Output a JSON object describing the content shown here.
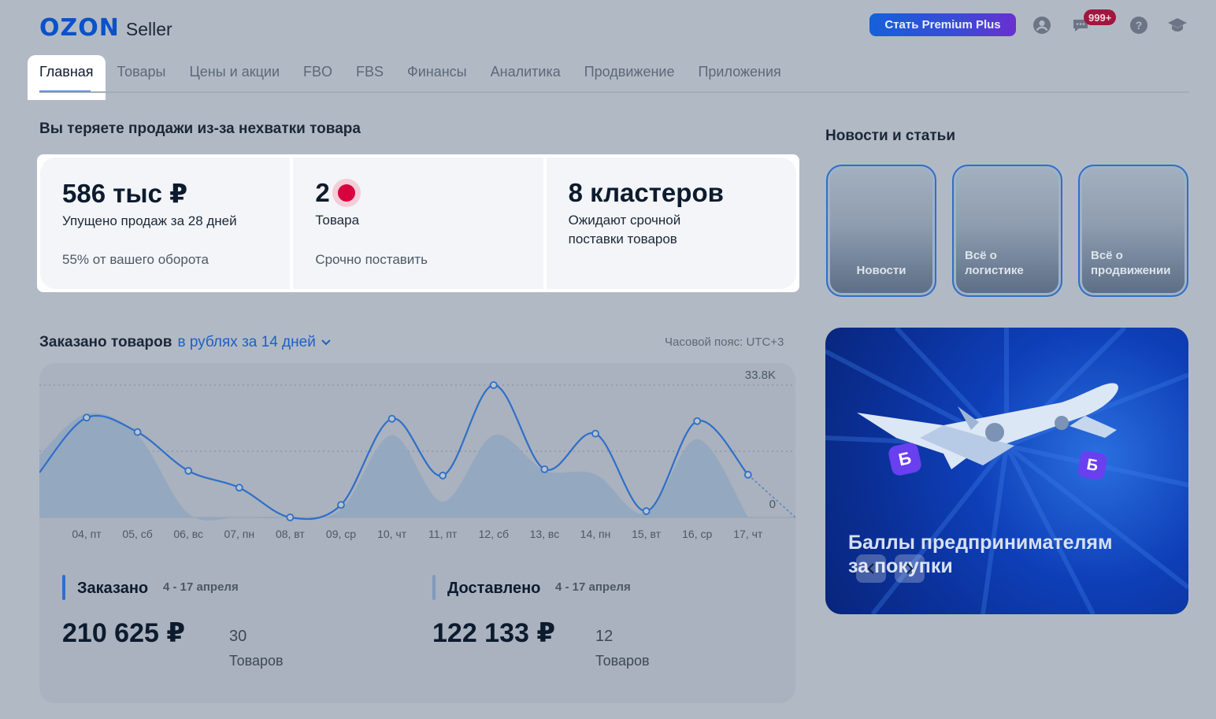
{
  "header": {
    "logo_main": "OZON",
    "logo_sub": "Seller",
    "premium_button": "Стать Premium Plus",
    "notifications_badge": "999+",
    "icons": [
      "profile-icon",
      "chat-icon",
      "help-icon",
      "education-icon"
    ]
  },
  "nav": {
    "tabs": [
      "Главная",
      "Товары",
      "Цены и акции",
      "FBO",
      "FBS",
      "Финансы",
      "Аналитика",
      "Продвижение",
      "Приложения"
    ],
    "active": "Главная"
  },
  "stock": {
    "title": "Вы теряете продажи из-за нехватки товара",
    "cells": [
      {
        "value": "586 тыс ₽",
        "label": "Упущено продаж за 28 дней",
        "note": "55% от вашего оборота"
      },
      {
        "value": "2",
        "label": "Товара",
        "note": "Срочно поставить"
      },
      {
        "value": "8 кластеров",
        "label": "Ожидают срочной поставки товаров",
        "note": ""
      }
    ]
  },
  "news": {
    "title": "Новости и статьи",
    "tiles": [
      "Новости",
      "Всё о логистике",
      "Всё о продвижении"
    ]
  },
  "promo": {
    "text_line1": "Баллы предпринимателям",
    "text_line2": "за покупки",
    "badge_letter": "Б"
  },
  "orders": {
    "title": "Заказано товаров",
    "period_link": "в рублях за 14 дней",
    "timezone": "Часовой пояс: UTC+3",
    "ordered": {
      "label": "Заказано",
      "period": "4 - 17 апреля",
      "amount": "210 625 ₽",
      "count": "30",
      "count_label": "Товаров"
    },
    "delivered": {
      "label": "Доставлено",
      "period": "4 - 17 апреля",
      "amount": "122 133 ₽",
      "count": "12",
      "count_label": "Товаров"
    }
  },
  "colors": {
    "brand": "#0a52c9",
    "line": "#2f6fc9",
    "area": "#91a6bf",
    "alert": "#d9023e"
  },
  "chart_data": {
    "type": "line",
    "categories": [
      "04, пт",
      "05, сб",
      "06, вс",
      "07, пн",
      "08, вт",
      "09, ср",
      "10, чт",
      "11, пт",
      "12, сб",
      "13, вс",
      "14, пн",
      "15, вт",
      "16, ср",
      "17, чт"
    ],
    "series": [
      {
        "values": [
          25500,
          21800,
          11900,
          7600,
          0,
          3200,
          25200,
          10700,
          33800,
          12300,
          21400,
          1600,
          24600,
          10900
        ]
      },
      {
        "values": [
          26500,
          21000,
          1000,
          0,
          0,
          2000,
          21000,
          4000,
          21000,
          12000,
          11000,
          1000,
          20000,
          0
        ]
      }
    ],
    "tick_labels": [
      "33.8K",
      "0"
    ],
    "ylim": [
      0,
      33800
    ],
    "grid": true
  }
}
